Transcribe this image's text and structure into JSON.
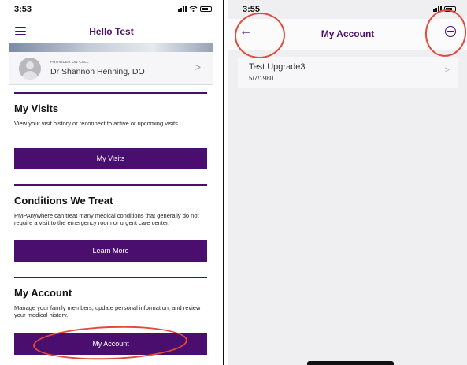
{
  "left_screen": {
    "status": {
      "time": "3:53"
    },
    "nav": {
      "title": "Hello Test"
    },
    "provider": {
      "label": "PROVIDER ON CALL",
      "name": "Dr Shannon Henning, DO",
      "chevron": ">"
    },
    "sections": {
      "visits": {
        "title": "My Visits",
        "description": "View your visit history or reconnect to active or upcoming visits.",
        "button": "My Visits"
      },
      "conditions": {
        "title": "Conditions We Treat",
        "description": "PMPAnywhere can treat many medical conditions that generally do not require a visit to the emergency room or urgent care center.",
        "button": "Learn More"
      },
      "account": {
        "title": "My Account",
        "description": "Manage your family members, update personal information, and review your medical history.",
        "button": "My Account"
      }
    }
  },
  "right_screen": {
    "status": {
      "time": "3:55"
    },
    "nav": {
      "title": "My Account",
      "back_glyph": "←"
    },
    "accounts": [
      {
        "name": "Test Upgrade3",
        "dob": "5/7/1980",
        "chevron": ">"
      }
    ]
  },
  "colors": {
    "brand_purple": "#4a0f6e",
    "annotation_red": "#e24a3b"
  },
  "icons": [
    "menu-icon",
    "avatar-icon",
    "chevron-right-icon",
    "back-arrow-icon",
    "add-circle-icon",
    "signal-icon",
    "wifi-icon",
    "battery-icon"
  ]
}
